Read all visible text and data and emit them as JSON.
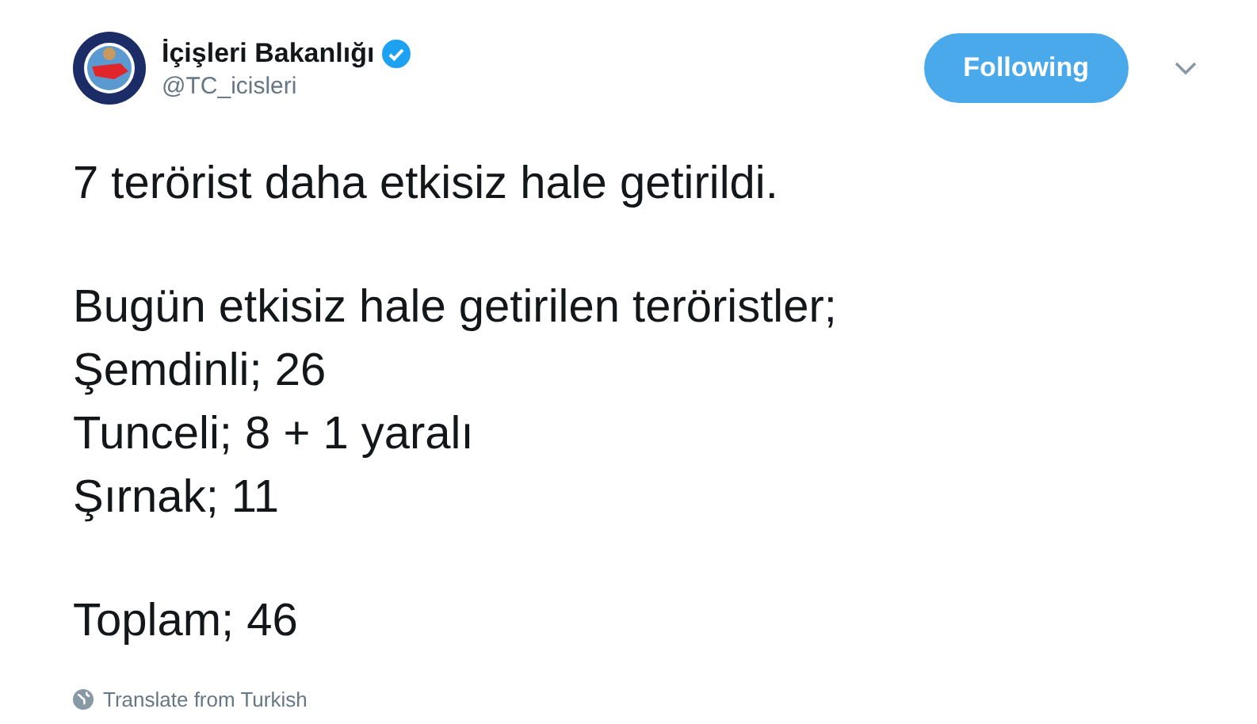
{
  "author": {
    "name": "İçişleri Bakanlığı",
    "verified": true,
    "handle": "@TC_icisleri"
  },
  "follow_button": {
    "label": "Following",
    "following": true
  },
  "tweet": {
    "paragraphs": [
      [
        "7 terörist daha etkisiz hale getirildi."
      ],
      [
        "Bugün etkisiz hale getirilen teröristler;",
        "Şemdinli; 26",
        "Tunceli; 8 + 1 yaralı",
        "Şırnak; 11"
      ],
      [
        "Toplam; 46"
      ]
    ]
  },
  "translate_link": "Translate from Turkish"
}
